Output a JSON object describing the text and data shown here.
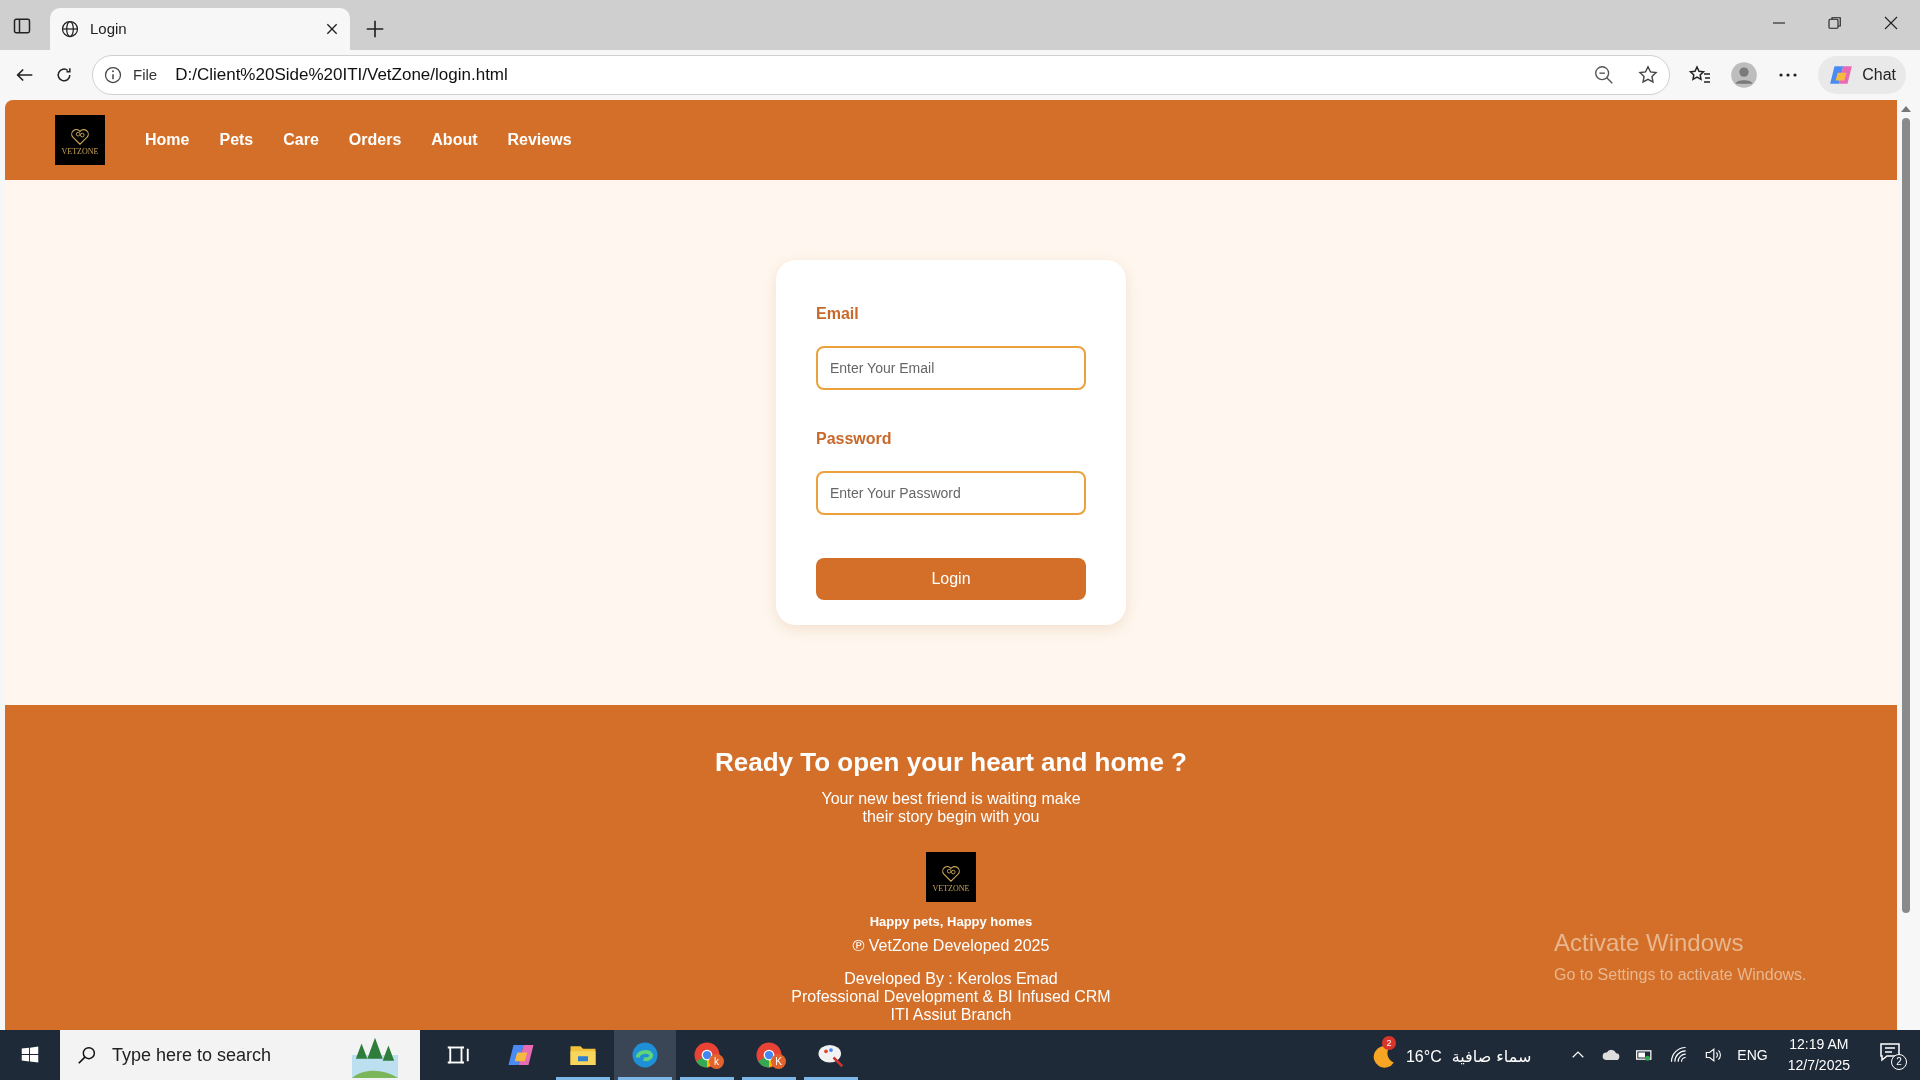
{
  "browser": {
    "tab_title": "Login",
    "address_scheme": "File",
    "url": "D:/Client%20Side%20ITI/VetZone/login.html",
    "chat_label": "Chat"
  },
  "navbar": {
    "logo_text": "VETZONE",
    "links": [
      "Home",
      "Pets",
      "Care",
      "Orders",
      "About",
      "Reviews"
    ]
  },
  "login_form": {
    "fields": [
      {
        "label": "Email",
        "placeholder": "Enter Your Email"
      },
      {
        "label": "Password",
        "placeholder": "Enter Your Password"
      }
    ],
    "submit": "Login"
  },
  "footer": {
    "heading": "Ready To open your heart and home ?",
    "subtitle_lines": [
      "Your new best friend is waiting make",
      "their story begin with you"
    ],
    "logo_text": "VETZONE",
    "tagline": "Happy pets, Happy homes",
    "copyright": "℗ VetZone Developed 2025",
    "credits": [
      "Developed By : Kerolos Emad",
      "Professional Development & BI Infused CRM",
      "ITI Assiut Branch"
    ]
  },
  "activation_notice": {
    "title": "Activate Windows",
    "subtitle": "Go to Settings to activate Windows."
  },
  "taskbar": {
    "search_placeholder": "Type here to search",
    "apps": [
      {
        "kind": "taskview",
        "running": false,
        "selected": false
      },
      {
        "kind": "copilot",
        "running": false,
        "selected": false
      },
      {
        "kind": "folder",
        "running": true,
        "selected": false
      },
      {
        "kind": "edge",
        "running": true,
        "selected": true
      },
      {
        "kind": "chrome",
        "badge": "k",
        "running": true,
        "selected": false
      },
      {
        "kind": "chrome",
        "badge": "K",
        "running": true,
        "selected": false
      },
      {
        "kind": "paint",
        "running": true,
        "selected": false
      }
    ],
    "weather": {
      "badge": "2",
      "temperature": "16°C",
      "condition": "سماء صافية"
    },
    "language": "ENG",
    "time": "12:19 AM",
    "date": "12/7/2025",
    "notification_count": "2"
  }
}
